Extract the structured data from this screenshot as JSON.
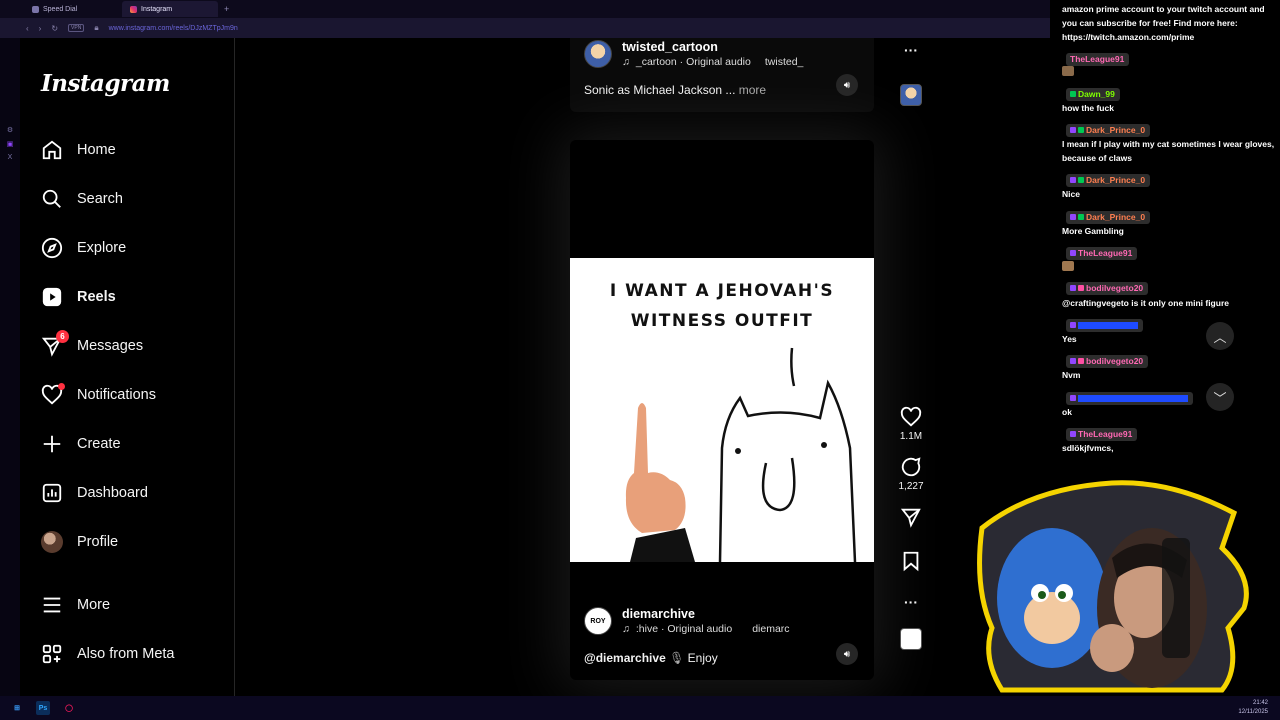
{
  "browser": {
    "tabs": [
      {
        "label": "Speed Dial",
        "active": false
      },
      {
        "label": "Instagram",
        "active": true
      }
    ],
    "vpn_label": "VPN",
    "url": "www.instagram.com/reels/DJzMZTpJm9n"
  },
  "sidebar": {
    "logo": "Instagram",
    "items": [
      {
        "label": "Home",
        "icon": "home-icon"
      },
      {
        "label": "Search",
        "icon": "search-icon"
      },
      {
        "label": "Explore",
        "icon": "compass-icon"
      },
      {
        "label": "Reels",
        "icon": "reels-icon",
        "active": true
      },
      {
        "label": "Messages",
        "icon": "messenger-icon",
        "badge": "6"
      },
      {
        "label": "Notifications",
        "icon": "heart-icon",
        "dot": true
      },
      {
        "label": "Create",
        "icon": "plus-icon"
      },
      {
        "label": "Dashboard",
        "icon": "chart-icon"
      },
      {
        "label": "Profile",
        "icon": "avatar"
      },
      {
        "label": "More",
        "icon": "menu-icon"
      },
      {
        "label": "Also from Meta",
        "icon": "grid-icon"
      }
    ]
  },
  "reel_top": {
    "username": "twisted_cartoon",
    "audio": "_cartoon · Original audio",
    "audio_scroll": "twisted_",
    "caption": "Sonic as Michael Jackson ...",
    "more": "more"
  },
  "reel_main": {
    "comic_text_line1": "I WANT A JEHOVAH'S",
    "comic_text_line2": "WITNESS OUTFIT",
    "username": "diemarchive",
    "audio": ":hive · Original audio",
    "audio_scroll": "diemarc",
    "caption_handle": "@diemarchive",
    "caption_text": "Enjoy",
    "avatar_text": "ROY"
  },
  "actions": {
    "likes": "1.1M",
    "comments": "1,227"
  },
  "chat": {
    "messages": [
      {
        "user": "",
        "text": "amazon prime account to your twitch account and you can subscribe for free! Find more here: https://twitch.amazon.com/prime",
        "color": ""
      },
      {
        "user": "TheLeague91",
        "text": "",
        "color": "#ff69b4"
      },
      {
        "user": "Dawn_99",
        "text": "how the fuck",
        "color": "#7fff00"
      },
      {
        "user": "Dark_Prince_0",
        "text": "I mean if I play with my cat sometimes I wear gloves, because of claws",
        "color": "#ff7f50"
      },
      {
        "user": "Dark_Prince_0",
        "text": "Nice",
        "color": "#ff7f50"
      },
      {
        "user": "Dark_Prince_0",
        "text": "More Gambling",
        "color": "#ff7f50"
      },
      {
        "user": "TheLeague91",
        "text": "",
        "color": "#ff69b4"
      },
      {
        "user": "bodilvegeto20",
        "text": "@craftingvegeto is it only one mini figure",
        "color": "#ff69b4"
      },
      {
        "user": "",
        "text": "Yes",
        "color": "#1e4bff"
      },
      {
        "user": "bodilvegeto20",
        "text": "Nvm",
        "color": "#ff69b4"
      },
      {
        "user": "",
        "text": "ok",
        "color": "#1e4bff"
      },
      {
        "user": "TheLeague91",
        "text": "sdlökjfvmcs,",
        "color": "#ff69b4"
      }
    ]
  },
  "taskbar": {
    "time": "21:42",
    "date": "12/11/2025"
  }
}
